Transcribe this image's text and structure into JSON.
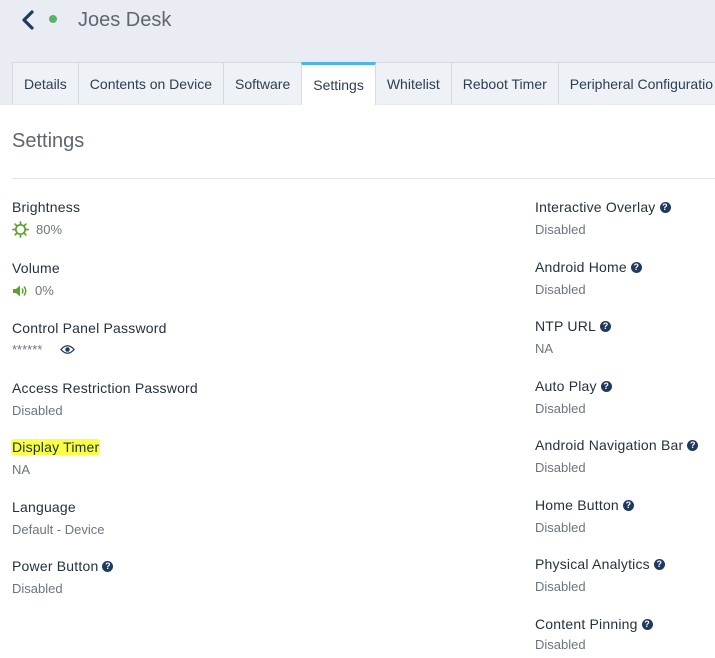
{
  "header": {
    "device_name": "Joes Desk",
    "status_color": "#58b368"
  },
  "tabs": [
    {
      "label": "Details"
    },
    {
      "label": "Contents on Device"
    },
    {
      "label": "Software"
    },
    {
      "label": "Settings",
      "active": true
    },
    {
      "label": "Whitelist"
    },
    {
      "label": "Reboot Timer"
    },
    {
      "label": "Peripheral Configuratio"
    }
  ],
  "settings": {
    "title": "Settings",
    "left": {
      "brightness": {
        "label": "Brightness",
        "value": "80%",
        "icon": "brightness-icon"
      },
      "volume": {
        "label": "Volume",
        "value": "0%",
        "icon": "volume-icon"
      },
      "control_panel_password": {
        "label": "Control Panel Password",
        "value": "******",
        "icon": "eye-icon"
      },
      "access_restriction_password": {
        "label": "Access Restriction Password",
        "value": "Disabled"
      },
      "display_timer": {
        "label": "Display Timer",
        "value": "NA",
        "highlight_color": "#f9ff42"
      },
      "language": {
        "label": "Language",
        "value": "Default - Device"
      },
      "power_button": {
        "label": "Power Button",
        "value": "Disabled"
      }
    },
    "right": {
      "interactive_overlay": {
        "label": "Interactive Overlay",
        "value": "Disabled"
      },
      "android_home": {
        "label": "Android Home",
        "value": "Disabled"
      },
      "ntp_url": {
        "label": "NTP URL",
        "value": "NA"
      },
      "auto_play": {
        "label": "Auto Play",
        "value": "Disabled"
      },
      "android_navigation_bar": {
        "label": "Android Navigation Bar",
        "value": "Disabled"
      },
      "home_button": {
        "label": "Home Button",
        "value": "Disabled"
      },
      "physical_analytics": {
        "label": "Physical Analytics",
        "value": "Disabled"
      },
      "content_pinning": {
        "label": "Content Pinning",
        "value": "Disabled"
      }
    },
    "help_glyph": "?"
  }
}
